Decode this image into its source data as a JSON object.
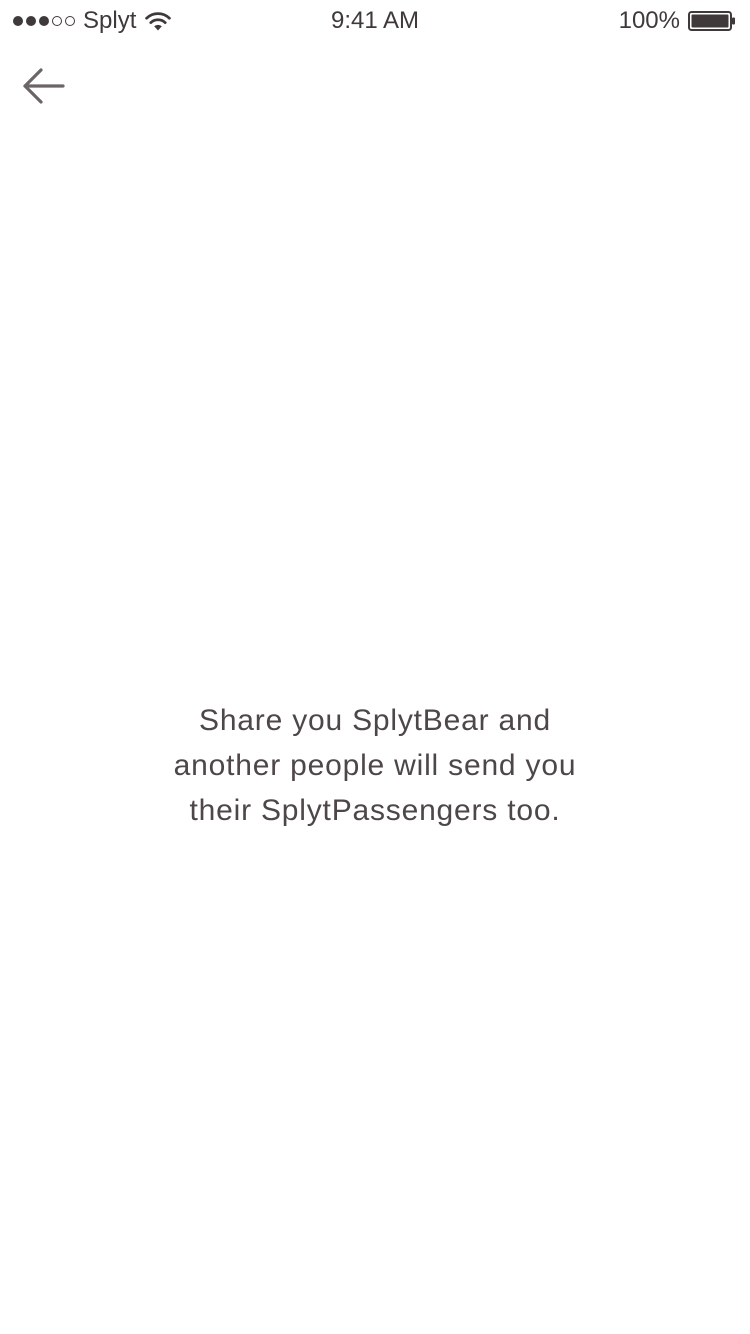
{
  "status_bar": {
    "signal_bars_filled": 3,
    "signal_bars_total": 5,
    "carrier": "Splyt",
    "wifi_icon": "wifi-icon",
    "time": "9:41 AM",
    "battery_percent": "100%",
    "battery_level": 1.0,
    "battery_icon": "battery-icon"
  },
  "nav": {
    "back_icon": "back-arrow-icon"
  },
  "message": {
    "lines": [
      "Share you SplytBear and",
      "another people will send you",
      "their SplytPassengers too."
    ]
  },
  "colors": {
    "background": "#ffffff",
    "text": "#4e4749",
    "icon": "#6b6567"
  }
}
